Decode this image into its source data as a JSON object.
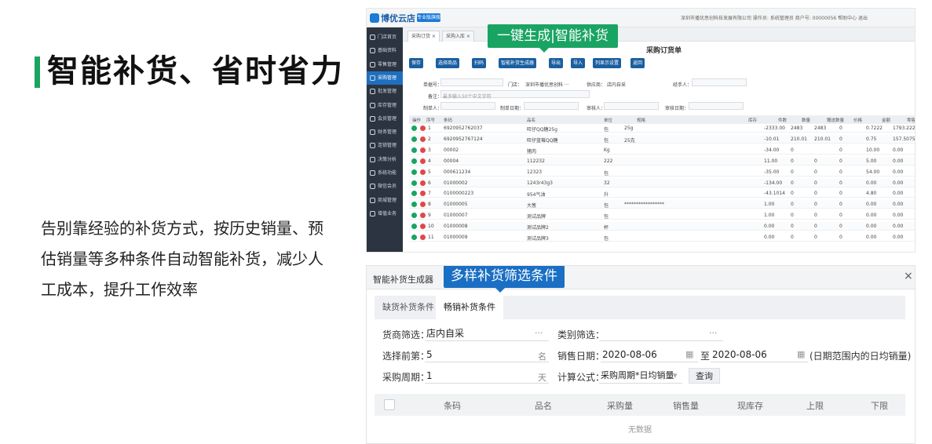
{
  "hero": {
    "title": "智能补货、省时省力",
    "desc": "告别靠经验的补货方式，按历史销量、预估销量等多种条件自动智能补货，减少人工成本，提升工作效率"
  },
  "app": {
    "logo": "博优云店",
    "badge": "专业版旗舰",
    "info": "深圳市播优思创科技发展有限公司   操作员: 系统管理员   商户号: 00000056   帮助中心   退出"
  },
  "sidebar": [
    "门店首页",
    "基础资料",
    "零售管理",
    "采购管理",
    "批发管理",
    "库存管理",
    "会员管理",
    "财务管理",
    "连锁管理",
    "决策分析",
    "系统功能",
    "微信会员",
    "商城管理",
    "增值业务"
  ],
  "tabs": [
    "采购订货 ×",
    "采购入库 ×"
  ],
  "callout1": "一键生成|智能补货",
  "doc": {
    "title": "采购订货单"
  },
  "toolbar": [
    "保存",
    "选择商品",
    "扫码",
    "智能补货生成器",
    "导出",
    "导入",
    "列显示设置",
    "返回"
  ],
  "form": {
    "order_no": "单据号：",
    "store_label": "门店：",
    "store": "深圳市播优思创科 ···",
    "supplier_label": "供应商：",
    "supplier": "店内自采",
    "handler": "经手人：",
    "remark": "备注：",
    "remark_ph": "最多输入50个中文字符",
    "maker": "制单人：",
    "make_date": "制单日期：",
    "auditor": "审核人：",
    "audit_date": "审核日期："
  },
  "table": {
    "headers": [
      "操作",
      "序号",
      "条码",
      "品名",
      "单位",
      "规格",
      "库存",
      "件数",
      "数量",
      "赠送数量",
      "价格",
      "金额",
      "零售"
    ],
    "rows": [
      [
        "1",
        "6920952762037",
        "旺仔QQ糖25g",
        "包",
        "25g",
        "-2333.00",
        "2483",
        "2483",
        "0",
        "0.7222",
        "1793.2226"
      ],
      [
        "2",
        "6920952767124",
        "旺仔蓝莓QQ糖",
        "包",
        "25克",
        "-10.01",
        "210.01",
        "210.01",
        "0",
        "0.75",
        "157.5075"
      ],
      [
        "3",
        "00002",
        "猪肉",
        "Kg",
        "",
        "-34.00",
        "0",
        "",
        "0",
        "10.00",
        "0.00"
      ],
      [
        "4",
        "00004",
        "112232",
        "222",
        "",
        "11.00",
        "0",
        "0",
        "0",
        "5.00",
        "0.00"
      ],
      [
        "5",
        "000611234",
        "12323",
        "包",
        "",
        "-35.00",
        "0",
        "0",
        "0",
        "54.00",
        "0.00"
      ],
      [
        "6",
        "01000002",
        "1243r43g3",
        "32",
        "",
        "-134.00",
        "0",
        "0",
        "0",
        "0.00",
        "0.00"
      ],
      [
        "7",
        "0100000223",
        "954气油",
        "升",
        "",
        "-43.1014",
        "0",
        "0",
        "0",
        "4.80",
        "0.00"
      ],
      [
        "8",
        "01000005",
        "大葱",
        "包",
        "*****************",
        "1.00",
        "0",
        "0",
        "0",
        "0.00",
        "0.00"
      ],
      [
        "9",
        "01000007",
        "测试品牌",
        "包",
        "",
        "1.00",
        "0",
        "0",
        "0",
        "0.00",
        "0.00"
      ],
      [
        "10",
        "01000008",
        "测试品牌2",
        "杯",
        "",
        "0.00",
        "0",
        "0",
        "0",
        "0.00",
        "0.00"
      ],
      [
        "11",
        "01000009",
        "测试品牌3",
        "包",
        "",
        "0.00",
        "0",
        "0",
        "0",
        "0.00",
        "0.00"
      ]
    ]
  },
  "dialog": {
    "title": "智能补货生成器",
    "close": "×",
    "callout": "多样补货筛选条件",
    "tabs": [
      "缺货补货条件",
      "畅销补货条件"
    ],
    "supplier_label": "货商筛选：",
    "supplier": "店内自采",
    "category_label": "类别筛选：",
    "dots": "···",
    "top_label": "选择前第：",
    "top": "5",
    "top_unit": "名",
    "sales_date_label": "销售日期：",
    "date_from": "2020-08-06",
    "to": "至",
    "date_to": "2020-08-06",
    "date_note": "(日期范围内的日均销量)",
    "period_label": "采购周期：",
    "period": "1",
    "period_unit": "天",
    "formula_label": "计算公式：",
    "formula": "采购周期*日均销量",
    "query": "查询",
    "grid_headers": [
      "条码",
      "品名",
      "采购量",
      "销售量",
      "现库存",
      "上限",
      "下限"
    ],
    "empty": "无数据"
  }
}
